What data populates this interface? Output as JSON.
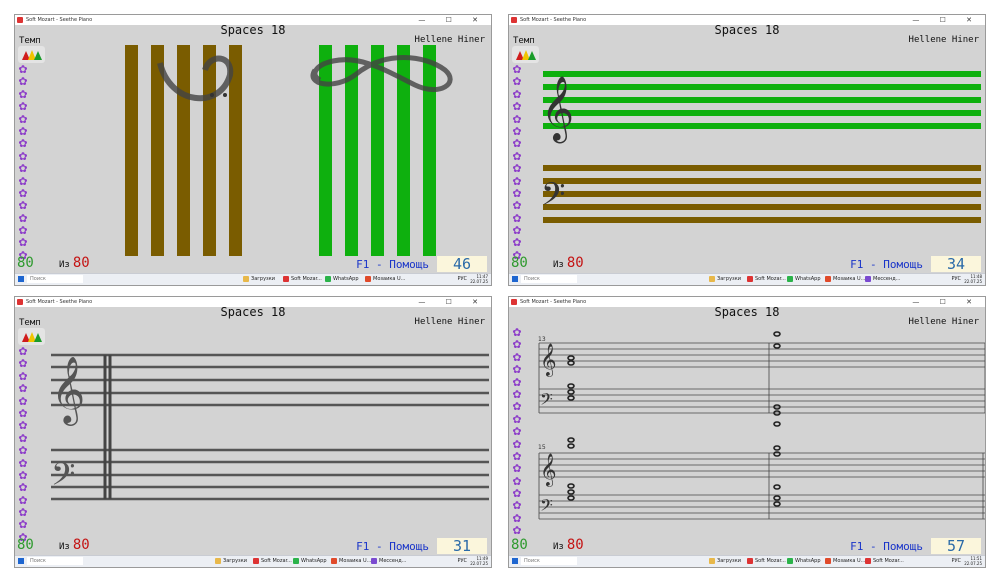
{
  "window_title": "Soft Mozart - Seethe Piano",
  "window_buttons": "— ☐ ✕",
  "panels": [
    {
      "title": "Spaces 18",
      "user": "Hellene Hiner",
      "tempo": "Темп",
      "score": "80",
      "iz_label": "Из",
      "iz_value": "80",
      "help": "F1 - Помощь",
      "counter": "46"
    },
    {
      "title": "Spaces 18",
      "user": "Hellene Hiner",
      "tempo": "Темп",
      "score": "80",
      "iz_label": "Из",
      "iz_value": "80",
      "help": "F1 - Помощь",
      "counter": "34"
    },
    {
      "title": "Spaces 18",
      "user": "Hellene Hiner",
      "tempo": "Темп",
      "score": "80",
      "iz_label": "Из",
      "iz_value": "80",
      "help": "F1 - Помощь",
      "counter": "31"
    },
    {
      "title": "Spaces 18",
      "user": "Hellene Hiner",
      "tempo": "",
      "score": "80",
      "iz_label": "Из",
      "iz_value": "80",
      "help": "F1 - Помощь",
      "counter": "57"
    }
  ],
  "measure_numbers": [
    "13",
    "15"
  ],
  "taskbar": {
    "search_placeholder": "Поиск",
    "apps": [
      {
        "label": "Загрузки",
        "icon": "folder-icon"
      },
      {
        "label": "Soft Mozar...",
        "icon": "soft-mozart-icon"
      },
      {
        "label": "WhatsApp",
        "icon": "whatsapp-icon"
      },
      {
        "label": "Мозаикa U...",
        "icon": "browser-icon"
      },
      {
        "label": "Мессенд...",
        "icon": "messenger-icon"
      },
      {
        "label": "Soft Mozar...",
        "icon": "soft-mozart-icon"
      }
    ],
    "language": "РУС",
    "clock_times": [
      "11:47",
      "11:48",
      "11:49",
      "11:51"
    ],
    "clock_date": "22.07.25"
  },
  "colors": {
    "panel_bg": "#d3d3d3",
    "brown": "#7a5c00",
    "green": "#0eb00e",
    "flower": "#8d3ec9",
    "score_green": "#2e9a2e",
    "iz_red": "#c41414",
    "help_blue": "#1a35c9"
  }
}
